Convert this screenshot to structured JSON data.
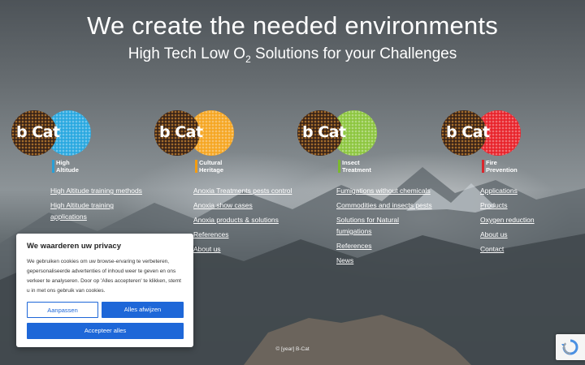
{
  "hero": {
    "title": "We create the needed environments",
    "subtitle_pre": "High Tech Low O",
    "subtitle_sub": "2",
    "subtitle_post": " Solutions for your Challenges"
  },
  "columns": [
    {
      "logo_text": "b Cat",
      "caption_line1": "High",
      "caption_line2": "Altitude",
      "accent": "#29a8e0",
      "bar_color": "#2a9fd6",
      "links": [
        "High Altitude training methods",
        "High Altitude training applications"
      ]
    },
    {
      "logo_text": "b Cat",
      "caption_line1": "Cultural",
      "caption_line2": "Heritage",
      "accent": "#f5a623",
      "bar_color": "#f39c12",
      "links": [
        "Anoxia Treatments pests control",
        "Anoxia show cases",
        "Anoxia products & solutions",
        "References",
        "About us"
      ]
    },
    {
      "logo_text": "b Cat",
      "caption_line1": "Insect",
      "caption_line2": "Treatment",
      "accent": "#8dc63f",
      "bar_color": "#7cb82f",
      "links": [
        "Fumigations without chemicals",
        "Commodities and insects pests",
        "Solutions for Natural fumigations",
        "References",
        "News"
      ]
    },
    {
      "logo_text": "b Cat",
      "caption_line1": "Fire",
      "caption_line2": "Prevention",
      "accent": "#e8232b",
      "bar_color": "#d9262d",
      "links": [
        "Applications",
        "Products",
        "Oxygen reduction",
        "About us",
        "Contact"
      ]
    }
  ],
  "cookie": {
    "title": "We waarderen uw privacy",
    "body": "We gebruiken cookies om uw browse-ervaring te verbeteren, gepersonaliseerde advertenties of inhoud weer te geven en ons verkeer te analyseren. Door op 'Alles accepteren' te klikken, stemt u in met ons gebruik van cookies.",
    "customize_label": "Aanpassen",
    "reject_label": "Alles afwijzen",
    "accept_label": "Accepteer alles"
  },
  "footer": {
    "text": "© [year] B-Cat"
  },
  "icons": {
    "recaptcha": "recaptcha-icon"
  }
}
